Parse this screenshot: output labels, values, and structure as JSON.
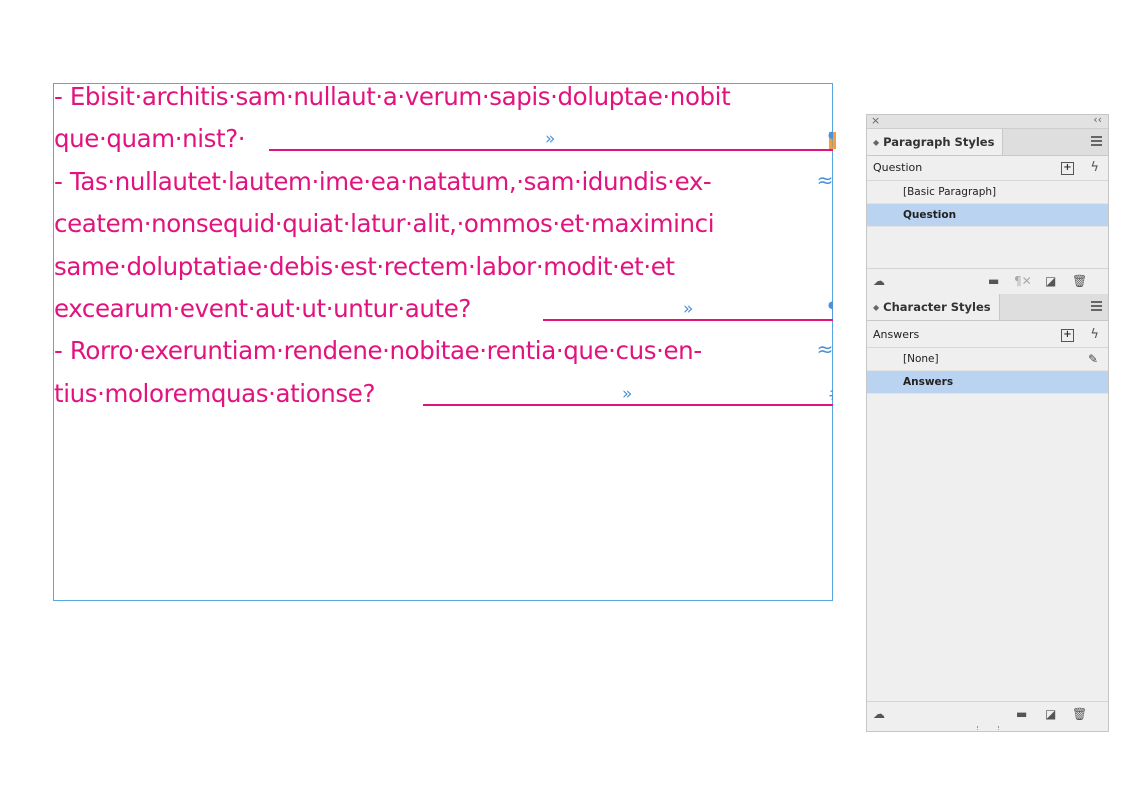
{
  "document": {
    "lines": [
      {
        "text": "- Ebisit·architis·sam·nullaut·a·verum·sapis·doluptae·nobit",
        "marker": ""
      },
      {
        "text": "que·quam·nist?·",
        "marker": "pilcrow"
      },
      {
        "text": "- Tas·nullautet·lautem·ime·ea·natatum,·sam·idundis·ex-",
        "marker": "hyphen"
      },
      {
        "text": "ceatem·nonsequid·quiat·latur·alit,·ommos·et·maximinci",
        "marker": ""
      },
      {
        "text": "same·doluptatiae·debis·est·rectem·labor·modit·et·et",
        "marker": ""
      },
      {
        "text": "excearum·event·aut·ut·untur·aute?",
        "marker": "pilcrow"
      },
      {
        "text": "- Rorro·exeruntiam·rendene·nobitae·rentia·que·cus·en-",
        "marker": "hyphen"
      },
      {
        "text": "tius·moloremquas·ationse?",
        "marker": "end"
      }
    ],
    "tab_glyph": "»",
    "pilcrow_glyph": "¶",
    "hyphen_glyph": "≈",
    "end_glyph": "#",
    "text_color": "#e2127e",
    "frame_color": "#5aa7e0",
    "hidden_char_color": "#4b92d6"
  },
  "panel": {
    "close_glyph": "×",
    "collapse_glyph": "‹‹",
    "paragraph_styles": {
      "tab_label": "Paragraph Styles",
      "current": "Question",
      "items": [
        {
          "label": "[Basic Paragraph]",
          "selected": false
        },
        {
          "label": "Question",
          "selected": true
        }
      ],
      "footer_icons": [
        "cloud-library-icon",
        "folder-icon",
        "clear-overrides-icon",
        "new-style-icon",
        "trash-icon"
      ]
    },
    "character_styles": {
      "tab_label": "Character Styles",
      "current": "Answers",
      "items": [
        {
          "label": "[None]",
          "selected": false
        },
        {
          "label": "Answers",
          "selected": true
        }
      ],
      "footer_icons": [
        "cloud-library-icon",
        "folder-icon",
        "new-style-icon",
        "trash-icon"
      ]
    },
    "new_glyph": "+",
    "bolt_glyph": "ϟ",
    "accent_selected": "#b9d3f0"
  }
}
